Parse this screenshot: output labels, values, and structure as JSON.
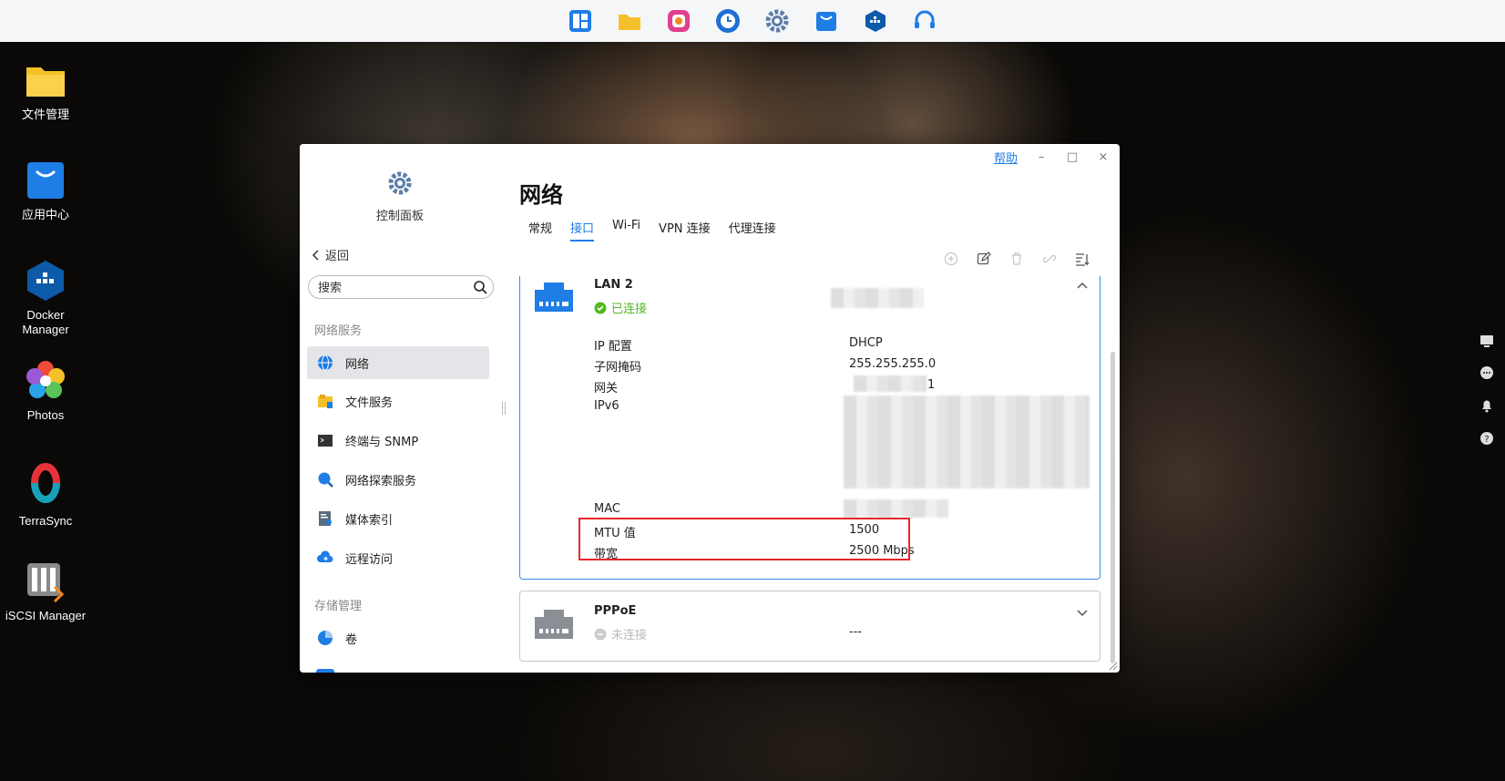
{
  "dock": {
    "items": [
      "launcher-icon",
      "file-manager-icon",
      "photos-app-icon",
      "backup-icon",
      "settings-icon",
      "app-center-icon",
      "docker-icon",
      "support-icon"
    ],
    "colors": {
      "blue": "#1f7de6",
      "yellow": "#f6c02a"
    }
  },
  "desktop": {
    "icons": [
      {
        "label": "文件管理"
      },
      {
        "label": "应用中心"
      },
      {
        "label": "Docker\nManager",
        "line1": "Docker",
        "line2": "Manager"
      },
      {
        "label": "Photos"
      },
      {
        "label": "TerraSync"
      },
      {
        "label": "iSCSI Manager"
      }
    ]
  },
  "window": {
    "help": "帮助",
    "controls": {
      "minimize": "–",
      "maximize": "□",
      "close": "×"
    }
  },
  "sidebar": {
    "app_title": "控制面板",
    "back": "返回",
    "search_placeholder": "搜索",
    "groups": [
      {
        "label": "网络服务",
        "items": [
          {
            "label": "网络",
            "icon": "globe-icon",
            "active": true
          },
          {
            "label": "文件服务",
            "icon": "file-service-icon"
          },
          {
            "label": "终端与 SNMP",
            "icon": "terminal-icon"
          },
          {
            "label": "网络探索服务",
            "icon": "network-discovery-icon"
          },
          {
            "label": "媒体索引",
            "icon": "media-index-icon"
          },
          {
            "label": "远程访问",
            "icon": "remote-access-icon"
          }
        ]
      },
      {
        "label": "存储管理",
        "items": [
          {
            "label": "卷",
            "icon": "volume-icon"
          }
        ]
      }
    ]
  },
  "main": {
    "title": "网络",
    "tabs": [
      {
        "label": "常规"
      },
      {
        "label": "接口",
        "active": true
      },
      {
        "label": "Wi-Fi"
      },
      {
        "label": "VPN 连接"
      },
      {
        "label": "代理连接"
      }
    ],
    "toolbar": [
      "add-icon",
      "edit-icon",
      "delete-icon",
      "link-icon",
      "sort-icon"
    ],
    "interfaces": [
      {
        "name": "LAN 2",
        "status": "已连接",
        "status_color": "#52b723",
        "details": [
          {
            "label": "IP 配置",
            "value": "DHCP"
          },
          {
            "label": "子网掩码",
            "value": "255.255.255.0"
          },
          {
            "label": "网关",
            "value": "1"
          },
          {
            "label": "IPv6",
            "value": ""
          },
          {
            "label": "MAC",
            "value": ""
          },
          {
            "label": "MTU 值",
            "value": "1500"
          },
          {
            "label": "带宽",
            "value": "2500 Mbps"
          }
        ]
      },
      {
        "name": "PPPoE",
        "status": "未连接",
        "status_color": "#bbbbbb",
        "value": "---"
      }
    ]
  }
}
